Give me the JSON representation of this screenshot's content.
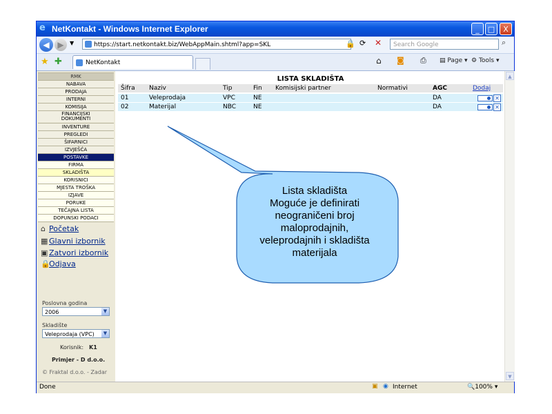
{
  "window": {
    "title": "NetKontakt - Windows Internet Explorer",
    "minimize": "_",
    "maximize": "□",
    "close": "X"
  },
  "address": {
    "url": "https://start.netkontakt.biz/WebAppMain.shtml?app=SKL",
    "search_placeholder": "Search Google"
  },
  "tab": {
    "label": "NetKontakt"
  },
  "commands": {
    "page": "Page",
    "tools": "Tools"
  },
  "sidebar": {
    "header": "RMK",
    "items": [
      "NABAVA",
      "PRODAJA",
      "INTERNI",
      "KOMISIJA",
      "FINANCIJSKI",
      "DOKUMENTI",
      "INVENTURE",
      "PREGLEDI",
      "ŠIFARNICI",
      "IZVJEŠĆA",
      "POSTAVKE",
      "FIRMA",
      "SKLADIŠTA",
      "KORISNICI",
      "MJESTA TROŠKA",
      "IZJAVE",
      "PORUKE",
      "TEČAJNA LISTA",
      "DOPUNSKI PODACI"
    ],
    "links": [
      "Početak",
      "Glavni izbornik",
      "Zatvori izbornik",
      "Odjava"
    ],
    "year_label": "Poslovna godina",
    "year_value": "2006",
    "warehouse_label": "Skladište",
    "warehouse_value": "Veleprodaja (VPC)",
    "user_label": "Korisnik:",
    "user_value": "K1",
    "company": "Primjer - D d.o.o.",
    "footer": "© Fraktal d.o.o. - Zadar"
  },
  "table": {
    "title": "LISTA SKLADIŠTA",
    "headers": [
      "Šifra",
      "Naziv",
      "Tip",
      "Fin",
      "Komisijski partner",
      "Normativi",
      "AGC"
    ],
    "add_link": "Dodaj",
    "rows": [
      [
        "01",
        "Veleprodaja",
        "VPC",
        "NE",
        "",
        "",
        "DA"
      ],
      [
        "02",
        "Materijal",
        "NBC",
        "NE",
        "",
        "",
        "DA"
      ]
    ]
  },
  "callout": {
    "lines": [
      "Lista skladišta",
      "Moguće je definirati",
      "neograničeni broj",
      "maloprodajnih,",
      "veleprodajnih i skladišta",
      "materijala"
    ]
  },
  "status": {
    "left": "Done",
    "zone": "Internet",
    "zoom": "100%"
  }
}
